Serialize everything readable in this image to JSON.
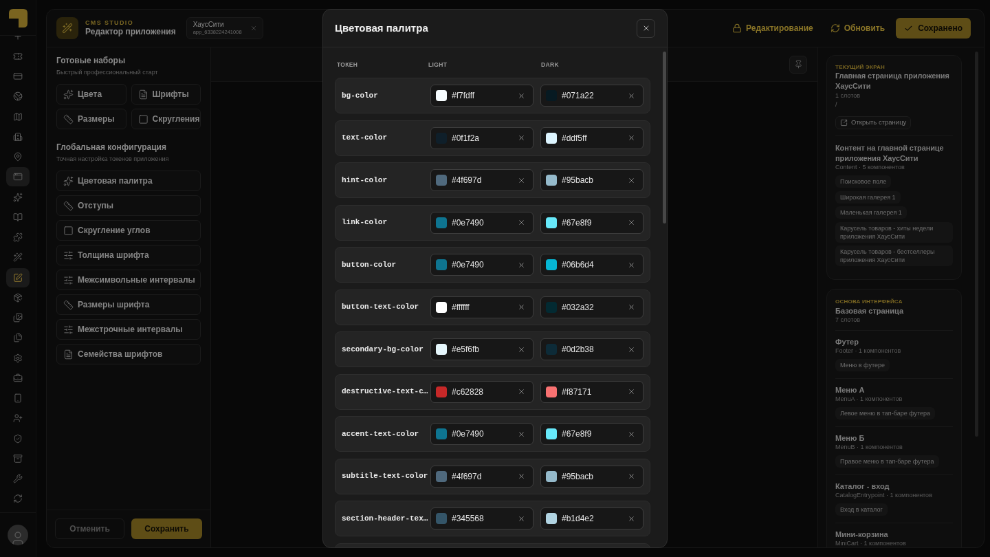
{
  "rail": {
    "items": [
      {
        "kind": "plus",
        "selected": false,
        "highlighted": false
      },
      {
        "kind": "ticket",
        "selected": false,
        "highlighted": false
      },
      {
        "kind": "card",
        "selected": false,
        "highlighted": false
      },
      {
        "kind": "globe",
        "selected": false,
        "highlighted": false
      },
      {
        "kind": "map",
        "selected": false,
        "highlighted": false
      },
      {
        "kind": "building",
        "selected": false,
        "highlighted": false
      },
      {
        "kind": "pin",
        "selected": false,
        "highlighted": false
      },
      {
        "kind": "window",
        "selected": false,
        "highlighted": true
      },
      {
        "kind": "sparkles",
        "selected": false,
        "highlighted": false
      },
      {
        "kind": "book",
        "selected": false,
        "highlighted": false
      },
      {
        "kind": "puzzle",
        "selected": false,
        "highlighted": false
      },
      {
        "kind": "wand",
        "selected": false,
        "highlighted": false
      },
      {
        "kind": "edit",
        "selected": true,
        "highlighted": true
      },
      {
        "kind": "package",
        "selected": false,
        "highlighted": false
      },
      {
        "kind": "images",
        "selected": false,
        "highlighted": false
      },
      {
        "kind": "files",
        "selected": false,
        "highlighted": false
      },
      {
        "kind": "settings",
        "selected": false,
        "highlighted": false
      },
      {
        "kind": "briefcase",
        "selected": false,
        "highlighted": false
      },
      {
        "kind": "phone",
        "selected": false,
        "highlighted": false
      },
      {
        "kind": "user-plus",
        "selected": false,
        "highlighted": false
      },
      {
        "kind": "shield",
        "selected": false,
        "highlighted": false
      },
      {
        "kind": "archive",
        "selected": false,
        "highlighted": false
      },
      {
        "kind": "wrench",
        "selected": false,
        "highlighted": false
      },
      {
        "kind": "refresh",
        "selected": false,
        "highlighted": false
      }
    ]
  },
  "header": {
    "brand_label": "CMS STUDIO",
    "title": "Редактор приложения",
    "tab": {
      "title": "ХаусСити",
      "subtitle": "app_6338224241008"
    },
    "actions": [
      {
        "kind": "lock",
        "label": "Редактирование"
      },
      {
        "kind": "refresh",
        "label": "Обновить"
      },
      {
        "kind": "saved",
        "label": "Сохранено"
      }
    ]
  },
  "config_panel": {
    "presets": {
      "title": "Готовые наборы",
      "subtitle": "Быстрый профессиональный старт",
      "items": [
        {
          "kind": "sparkles",
          "label": "Цвета"
        },
        {
          "kind": "file",
          "label": "Шрифты"
        },
        {
          "kind": "ruler",
          "label": "Размеры"
        },
        {
          "kind": "square",
          "label": "Скругления"
        }
      ]
    },
    "global": {
      "title": "Глобальная конфигурация",
      "subtitle": "Точная настройка токенов приложения",
      "items": [
        {
          "kind": "sparkles",
          "label": "Цветовая палитра"
        },
        {
          "kind": "ruler",
          "label": "Отступы"
        },
        {
          "kind": "square",
          "label": "Скругление углов"
        },
        {
          "kind": "sliders",
          "label": "Толщина шрифта"
        },
        {
          "kind": "sliders",
          "label": "Межсимвольные интервалы"
        },
        {
          "kind": "ruler",
          "label": "Размеры шрифта"
        },
        {
          "kind": "sliders",
          "label": "Межстрочные интервалы"
        },
        {
          "kind": "file",
          "label": "Семейства шрифтов"
        }
      ]
    },
    "footer": {
      "cancel": "Отменить",
      "save": "Сохранить"
    }
  },
  "right_panel": {
    "current_screen": {
      "eyebrow": "ТЕКУЩИЙ ЭКРАН",
      "title": "Главная страница приложения ХаусСити",
      "slots": "1 слотов",
      "path": "/",
      "open_button": "Открыть страницу",
      "sections": [
        {
          "title": "Контент на главной странице приложения ХаусСити",
          "meta": "Content · 5 компонентов",
          "components": [
            "Поисковое поле",
            "Широкая галерея 1",
            "Маленькая галерея 1",
            "Карусель товаров - хиты недели приложения ХаусСити",
            "Карусель товаров - бестселлеры приложения ХаусСити"
          ]
        }
      ]
    },
    "base": {
      "eyebrow": "ОСНОВА ИНТЕРФЕЙСА",
      "title": "Базовая страница",
      "slots": "7 слотов",
      "sections": [
        {
          "title": "Футер",
          "meta": "Footer · 1 компонентов",
          "components": [
            "Меню в футере"
          ]
        },
        {
          "title": "Меню А",
          "meta": "MenuA · 1 компонентов",
          "components": [
            "Левое меню в тап-баре футера"
          ]
        },
        {
          "title": "Меню Б",
          "meta": "MenuB · 1 компонентов",
          "components": [
            "Правое меню в тап-баре футера"
          ]
        },
        {
          "title": "Каталог - вход",
          "meta": "CatalogEntrypoint · 1 компонентов",
          "components": [
            "Вход в каталог"
          ]
        },
        {
          "title": "Мини-корзина",
          "meta": "MiniCart · 1 компонентов"
        }
      ]
    }
  },
  "modal": {
    "title": "Цветовая палитра",
    "columns": [
      "ТОКЕН",
      "LIGHT",
      "DARK"
    ],
    "tokens": [
      {
        "name": "bg-color",
        "light": {
          "value": "#f7fdff",
          "color": "#f7fdff"
        },
        "dark": {
          "value": "#071a22",
          "color": "#071a22"
        }
      },
      {
        "name": "text-color",
        "light": {
          "value": "#0f1f2a",
          "color": "#0f1f2a"
        },
        "dark": {
          "value": "#ddf5ff",
          "color": "#ddf5ff"
        }
      },
      {
        "name": "hint-color",
        "light": {
          "value": "#4f697d",
          "color": "#4f697d"
        },
        "dark": {
          "value": "#95bacb",
          "color": "#95bacb"
        }
      },
      {
        "name": "link-color",
        "light": {
          "value": "#0e7490",
          "color": "#0e7490"
        },
        "dark": {
          "value": "#67e8f9",
          "color": "#67e8f9"
        }
      },
      {
        "name": "button-color",
        "light": {
          "value": "#0e7490",
          "color": "#0e7490"
        },
        "dark": {
          "value": "#06b6d4",
          "color": "#06b6d4"
        }
      },
      {
        "name": "button-text-color",
        "light": {
          "value": "#ffffff",
          "color": "#ffffff"
        },
        "dark": {
          "value": "#032a32",
          "color": "#032a32"
        }
      },
      {
        "name": "secondary-bg-color",
        "light": {
          "value": "#e5f6fb",
          "color": "#e5f6fb"
        },
        "dark": {
          "value": "#0d2b38",
          "color": "#0d2b38"
        }
      },
      {
        "name": "destructive-text-c…",
        "light": {
          "value": "#c62828",
          "color": "#c62828"
        },
        "dark": {
          "value": "#f87171",
          "color": "#f87171"
        }
      },
      {
        "name": "accent-text-color",
        "light": {
          "value": "#0e7490",
          "color": "#0e7490"
        },
        "dark": {
          "value": "#67e8f9",
          "color": "#67e8f9"
        }
      },
      {
        "name": "subtitle-text-color",
        "light": {
          "value": "#4f697d",
          "color": "#4f697d"
        },
        "dark": {
          "value": "#95bacb",
          "color": "#95bacb"
        }
      },
      {
        "name": "section-header-tex…",
        "light": {
          "value": "#345568",
          "color": "#345568"
        },
        "dark": {
          "value": "#b1d4e2",
          "color": "#b1d4e2"
        }
      }
    ]
  }
}
